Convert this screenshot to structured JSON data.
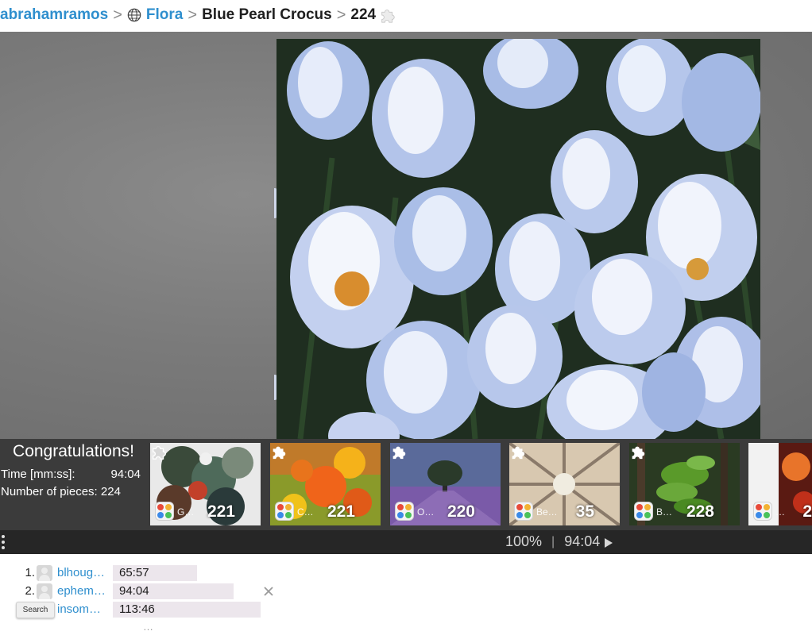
{
  "breadcrumb": {
    "user": "abrahamramos",
    "category": "Flora",
    "puzzle_title": "Blue Pearl Crocus",
    "piece_count": "224"
  },
  "congrats": {
    "title": "Congratulations!",
    "time_label": "Time [mm:ss]:",
    "time_value": "94:04",
    "pieces_label": "Number of pieces: 224"
  },
  "suggestions": [
    {
      "name": "G…",
      "count": "221",
      "piece_icon": "puzzle-piece-outline"
    },
    {
      "name": "C…",
      "count": "221",
      "piece_icon": "puzzle-piece-solid"
    },
    {
      "name": "O…",
      "count": "220",
      "piece_icon": "puzzle-piece-solid"
    },
    {
      "name": "Be…",
      "count": "35",
      "piece_icon": "puzzle-piece-solid"
    },
    {
      "name": "B…",
      "count": "228",
      "piece_icon": "puzzle-piece-solid"
    },
    {
      "name": "…",
      "count": "2",
      "piece_icon": "puzzle-piece-solid"
    }
  ],
  "status": {
    "zoom": "100%",
    "timer": "94:04"
  },
  "leaderboard": [
    {
      "rank": "1.",
      "name": "blhoug…",
      "time": "65:57"
    },
    {
      "rank": "2.",
      "name": "ephem…",
      "time": "94:04"
    },
    {
      "rank": "3.",
      "name": "insom…",
      "time": "113:46"
    }
  ],
  "tooltip": "Search",
  "more_indicator": "…",
  "colors": {
    "link": "#2f8fce",
    "strip_bg": "#3b3b3b",
    "status_bg": "#262626",
    "time_bar": "#ece6ec"
  }
}
